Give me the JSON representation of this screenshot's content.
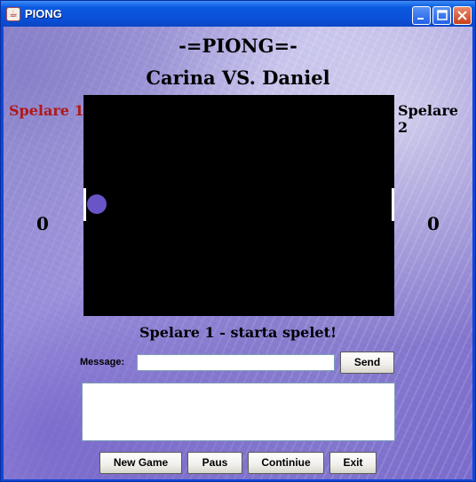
{
  "window": {
    "title": "PIONG",
    "app_icon": "java-cup-icon",
    "controls": {
      "minimize": "minimize-icon",
      "maximize": "maximize-icon",
      "close": "close-icon"
    }
  },
  "header": {
    "title": "-=PIONG=-",
    "matchup": "Carina VS. Daniel"
  },
  "players": {
    "left": {
      "label": "Spelare 1",
      "score": "0",
      "color": "#b01818"
    },
    "right": {
      "label": "Spelare 2",
      "score": "0",
      "color": "#000000"
    }
  },
  "court": {
    "background": "#000000",
    "ball_color": "#6a55c8",
    "paddle_color": "#ffffff"
  },
  "status": "Spelare 1 - starta spelet!",
  "chat": {
    "message_label": "Message:",
    "input_value": "",
    "send_label": "Send",
    "log": ""
  },
  "buttons": {
    "new_game": "New Game",
    "pause": "Paus",
    "continue": "Continiue",
    "exit": "Exit"
  }
}
